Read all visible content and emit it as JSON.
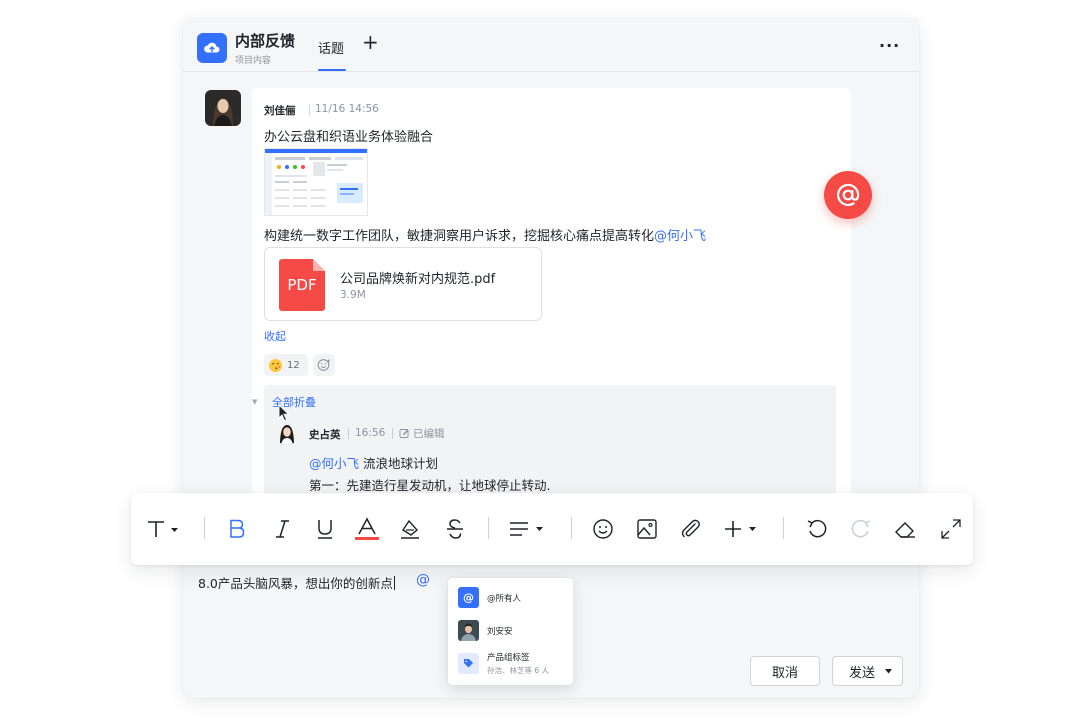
{
  "header": {
    "app_title": "内部反馈",
    "app_subtitle": "项目内容",
    "tab_topic": "话题",
    "add_tab": "+",
    "more": "···"
  },
  "message": {
    "author": "刘佳俪",
    "time": "11/16 14:56",
    "title": "办公云盘和织语业务体验融合",
    "body_prefix": "构建统一数字工作团队，敏捷洞察用户诉求，挖掘核心痛点提高转化",
    "body_mention": "@何小飞",
    "file": {
      "icon_text": "PDF",
      "name": "公司品牌焕新对内规范.pdf",
      "size": "3.9M"
    },
    "collapse": "收起",
    "reaction_count": "12"
  },
  "thread": {
    "fold_all": "全部折叠",
    "reply": {
      "author": "史占英",
      "time": "16:56",
      "edited": "已编辑",
      "mention": "@何小飞",
      "line1_text": " 流浪地球计划",
      "line2": "第一：先建造行星发动机，让地球停止转动."
    }
  },
  "toolbar": {
    "text_style": "T",
    "icons": [
      "text-style",
      "bold",
      "italic",
      "underline",
      "font-color",
      "highlight",
      "strikethrough",
      "align",
      "emoji",
      "image",
      "attachment",
      "insert",
      "undo",
      "redo",
      "eraser",
      "expand"
    ],
    "colors": {
      "font_color_bar": "#f54a45",
      "bold_active": "#3370ff"
    }
  },
  "editor": {
    "text": "8.0产品头脑风暴，想出你的创新点",
    "at": "@"
  },
  "mention_popup": {
    "items": [
      {
        "label": "@所有人",
        "sub": ""
      },
      {
        "label": "刘安安",
        "sub": ""
      },
      {
        "label": "产品组标签",
        "sub": "孙浩、林芝等 6 人"
      }
    ]
  },
  "actions": {
    "cancel": "取消",
    "send": "发送"
  },
  "colors": {
    "accent": "#3370ff",
    "danger": "#f54a45",
    "bg": "#f5f6f7"
  }
}
